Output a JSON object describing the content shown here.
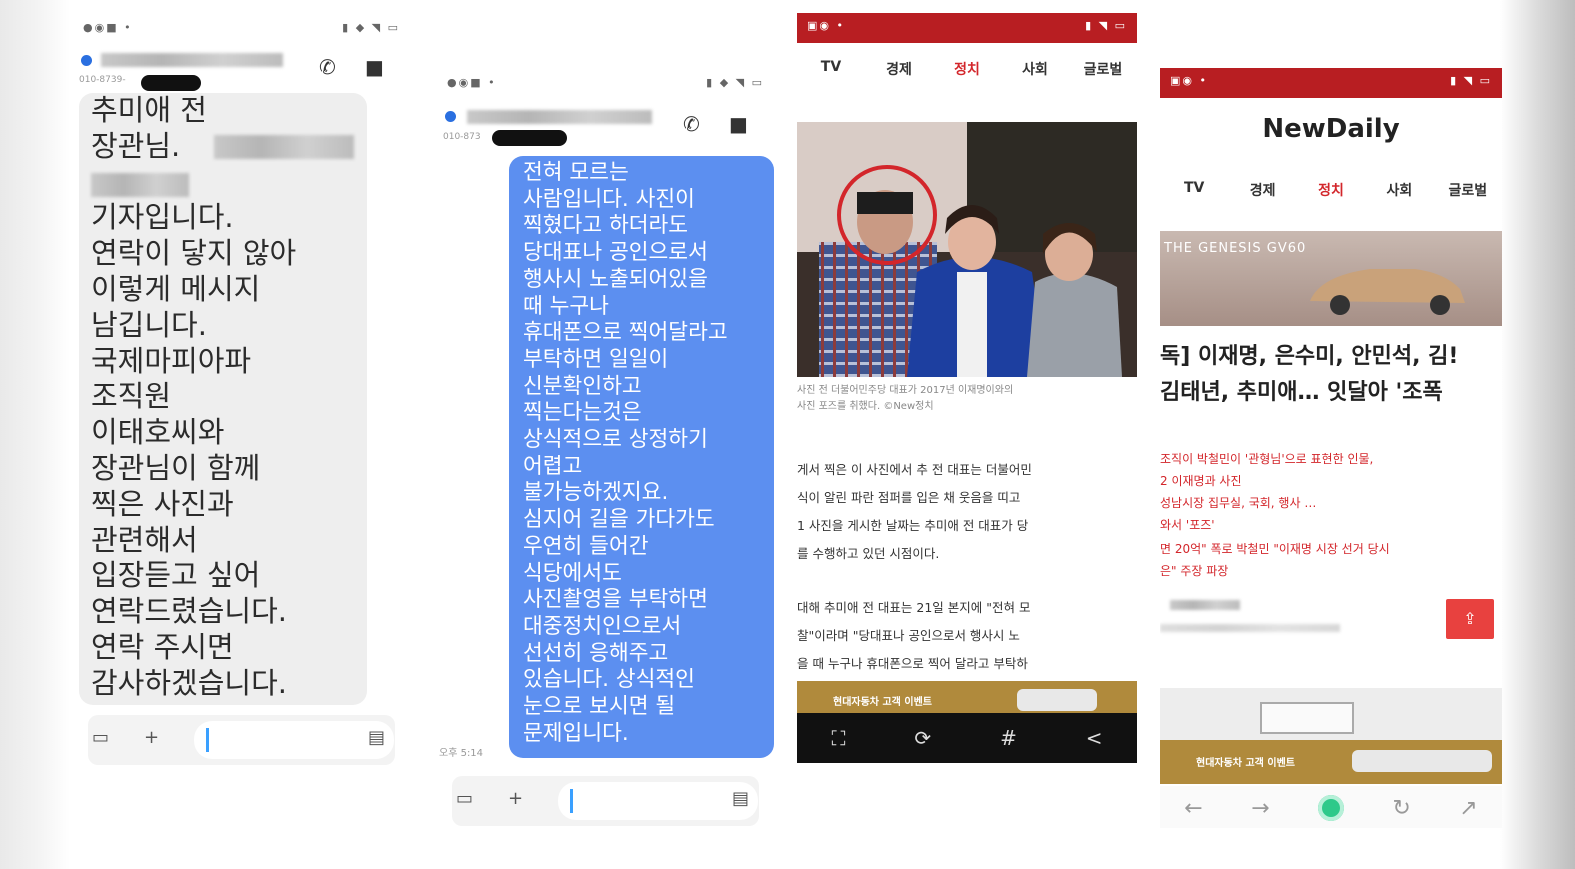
{
  "screen1": {
    "status_left": "●◉■ •",
    "status_right": "▮ ◆ ◥ ▭",
    "contact_number": "010-8739-",
    "message": "추미애  전\n장관님.\n\n기자입니다.\n연락이 닿지 않아\n이렇게 메시지\n남깁니다.\n국제마피아파\n조직원\n이태호씨와\n장관님이 함께\n찍은 사진과\n관련해서\n입장듣고 싶어\n연락드렸습니다.\n연락 주시면\n감사하겠습니다."
  },
  "screen2": {
    "status_left": "●◉■ •",
    "status_right": "▮ ◆ ◥ ▭",
    "contact_number": "010-873",
    "message": "전혀 모르는\n사람입니다. 사진이\n찍혔다고 하더라도\n당대표나 공인으로서\n행사시 노출되어있을\n때 누구나\n휴대폰으로 찍어달라고\n부탁하면 일일이\n신분확인하고\n찍는다는것은\n상식적으로 상정하기\n어렵고\n불가능하겠지요.\n심지어 길을 가다가도\n우연히 들어간\n식당에서도\n사진촬영을 부탁하면\n대중정치인으로서\n선선히 응해주고\n있습니다. 상식적인\n눈으로 보시면 될\n문제입니다.",
    "time": "오후 5:14"
  },
  "screen3": {
    "status_left": "▣◉ •",
    "status_right": "▮ ◥ ▭",
    "nav": [
      "TV",
      "경제",
      "정치",
      "사회",
      "글로벌"
    ],
    "caption": "사진 전 더불어민주당 대표가 2017년 이재명이와의\n사진 포즈를 취했다. ©New정치",
    "article_lines": [
      "게서 찍은 이 사진에서 추 전 대표는 더불어민",
      "식이 알린 파란 점퍼를 입은 채 웃음을 띠고",
      "1 사진을 게시한 날짜는 추미애 전 대표가 당",
      "를 수행하고 있던 시점이다.",
      "대해 추미애 전 대표는 21일 본지에 \"전혀 모",
      "찰\"이라며 \"당대표나 공인으로서 행사시 노",
      "을 때 누구나 휴대폰으로 찍어 달라고 부탁하"
    ],
    "ad_text": "현대자동차 고객 이벤트",
    "toolbar_icons": [
      "⛶",
      "⟳",
      "#",
      "<"
    ]
  },
  "screen4": {
    "status_left": "▣◉ •",
    "status_right": "▮ ◥ ▭",
    "logo": "NewDaily",
    "nav": [
      "TV",
      "경제",
      "정치",
      "사회",
      "글로벌"
    ],
    "banner_text": "THE GENESIS GV60",
    "headline_1": "독] 이재명, 은수미, 안민석, 김!",
    "headline_2": "김태년, 추미애… 잇달아 '조폭",
    "related": [
      "조직이 박철민이 '관형님'으로 표현한 인물, ",
      "2 이재명과 사진",
      "성남시장 집무실, 국회, 행사 …",
      "와서 '포즈'",
      "면 20억\" 폭로 박철민 \"이재명 시장 선거 당시",
      "은\" 주장 파장"
    ],
    "share_icon": "⇪",
    "ad_text": "현대자동차 고객 이벤트",
    "browser_icons": [
      "←",
      "→",
      "home",
      "↻",
      "↗"
    ]
  }
}
